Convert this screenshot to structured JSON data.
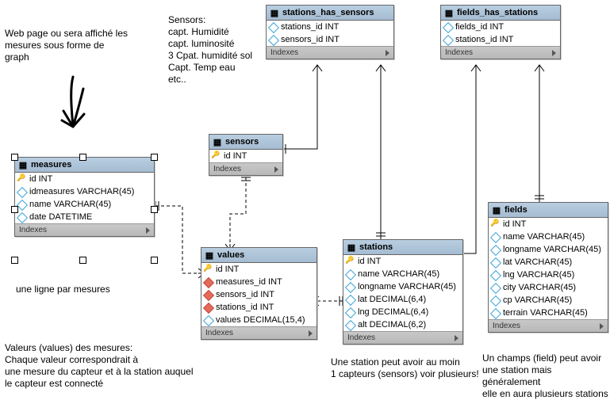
{
  "annotations": {
    "webpage": "Web page ou sera affiché les\nmesures sous forme de\ngraph",
    "sensors_note": "Sensors:\ncapt. Humidité\ncapt. luminosité\n3 Cpat. humidité sol\nCapt. Temp eau\netc..",
    "line_per_measure": "une ligne par mesures",
    "values_note": "Valeurs  (values) des mesures:\nChaque valeur correspondrait à\nune mesure du capteur et à la station auquel\nle capteur est connecté",
    "station_note": "Une station peut avoir au moin\n1 capteurs (sensors) voir plusieurs!",
    "field_note": "Un champs (field) peut avoir\nune station mais généralement\nelle en aura plusieurs stations"
  },
  "indexes_label": "Indexes",
  "tables": {
    "measures": {
      "name": "measures",
      "cols": [
        {
          "label": "id INT",
          "type": "pk"
        },
        {
          "label": "idmeasures VARCHAR(45)",
          "type": ""
        },
        {
          "label": "name VARCHAR(45)",
          "type": ""
        },
        {
          "label": "date DATETIME",
          "type": ""
        }
      ]
    },
    "sensors": {
      "name": "sensors",
      "cols": [
        {
          "label": "id INT",
          "type": "pk"
        }
      ]
    },
    "stations_has_sensors": {
      "name": "stations_has_sensors",
      "cols": [
        {
          "label": "stations_id INT",
          "type": ""
        },
        {
          "label": "sensors_id INT",
          "type": ""
        }
      ]
    },
    "fields_has_stations": {
      "name": "fields_has_stations",
      "cols": [
        {
          "label": "fields_id INT",
          "type": ""
        },
        {
          "label": "stations_id INT",
          "type": ""
        }
      ]
    },
    "values": {
      "name": "values",
      "cols": [
        {
          "label": "id INT",
          "type": "pk"
        },
        {
          "label": "measures_id INT",
          "type": "fk"
        },
        {
          "label": "sensors_id INT",
          "type": "fk"
        },
        {
          "label": "stations_id INT",
          "type": "fk"
        },
        {
          "label": "values DECIMAL(15,4)",
          "type": ""
        }
      ]
    },
    "stations": {
      "name": "stations",
      "cols": [
        {
          "label": "id INT",
          "type": "pk"
        },
        {
          "label": "name VARCHAR(45)",
          "type": ""
        },
        {
          "label": "longname VARCHAR(45)",
          "type": ""
        },
        {
          "label": "lat DECIMAL(6,4)",
          "type": ""
        },
        {
          "label": "lng DECIMAL(6,4)",
          "type": ""
        },
        {
          "label": "alt DECIMAL(6,2)",
          "type": ""
        }
      ]
    },
    "fields": {
      "name": "fields",
      "cols": [
        {
          "label": "id INT",
          "type": "pk"
        },
        {
          "label": "name VARCHAR(45)",
          "type": ""
        },
        {
          "label": "longname VARCHAR(45)",
          "type": ""
        },
        {
          "label": "lat VARCHAR(45)",
          "type": ""
        },
        {
          "label": "lng VARCHAR(45)",
          "type": ""
        },
        {
          "label": "city VARCHAR(45)",
          "type": ""
        },
        {
          "label": "cp VARCHAR(45)",
          "type": ""
        },
        {
          "label": "terrain VARCHAR(45)",
          "type": ""
        }
      ]
    }
  }
}
